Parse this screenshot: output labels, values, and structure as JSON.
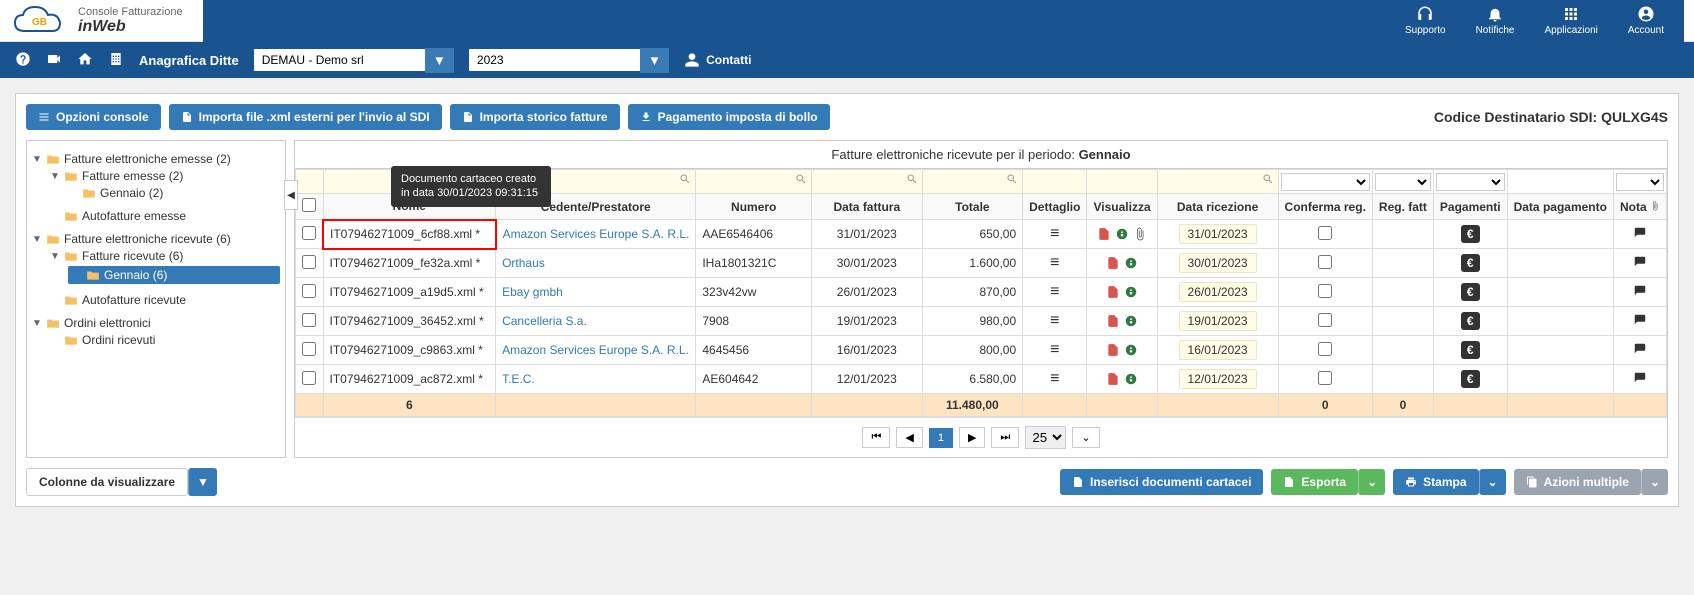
{
  "header": {
    "logo_line1": "Console Fatturazione",
    "logo_line2": "inWeb",
    "icons": [
      {
        "name": "supporto",
        "label": "Supporto"
      },
      {
        "name": "notifiche",
        "label": "Notifiche"
      },
      {
        "name": "applicazioni",
        "label": "Applicazioni"
      },
      {
        "name": "account",
        "label": "Account"
      }
    ]
  },
  "nav": {
    "anagrafica_label": "Anagrafica Ditte",
    "company_select": "DEMAU - Demo srl",
    "year_select": "2023",
    "contatti": "Contatti"
  },
  "toolbar": {
    "opzioni": "Opzioni console",
    "importa_xml": "Importa file .xml esterni per l'invio al SDI",
    "importa_storico": "Importa storico fatture",
    "pagamento_bollo": "Pagamento imposta di bollo",
    "sdi_label": "Codice Destinatario SDI: ",
    "sdi_code": "QULXG4S"
  },
  "tree": {
    "emesse": "Fatture elettroniche emesse (2)",
    "fatture_emesse": "Fatture emesse (2)",
    "gennaio_emesse": "Gennaio (2)",
    "autofatture_emesse": "Autofatture emesse",
    "ricevute": "Fatture elettroniche ricevute (6)",
    "fatture_ricevute": "Fatture ricevute (6)",
    "gennaio_ricevute": "Gennaio (6)",
    "autofatture_ricevute": "Autofatture ricevute",
    "ordini": "Ordini elettronici",
    "ordini_ricevuti": "Ordini ricevuti"
  },
  "table": {
    "title_prefix": "Fatture elettroniche ricevute per il periodo: ",
    "title_period": "Gennaio",
    "headers": {
      "nome": "Nome",
      "cedente": "Cedente/Prestatore",
      "numero": "Numero",
      "data_fattura": "Data fattura",
      "totale": "Totale",
      "dettaglio": "Dettaglio",
      "visualizza": "Visualizza",
      "data_ricezione": "Data ricezione",
      "conferma": "Conferma reg.",
      "reg_fatt": "Reg. fatt",
      "pagamenti": "Pagamenti",
      "data_pagamento": "Data pagamento",
      "nota": "Nota"
    },
    "tooltip": "Documento cartaceo creato in data 30/01/2023 09:31:15",
    "rows": [
      {
        "nome": "IT07946271009_6cf88.xml *",
        "cedente": "Amazon Services Europe S.A. R.L.",
        "numero": "AAE6546406",
        "data_fattura": "31/01/2023",
        "totale": "650,00",
        "data_ricezione": "31/01/2023",
        "has_clip": true
      },
      {
        "nome": "IT07946271009_fe32a.xml *",
        "cedente": "Orthaus",
        "numero": "IHa1801321C",
        "data_fattura": "30/01/2023",
        "totale": "1.600,00",
        "data_ricezione": "30/01/2023",
        "has_clip": false
      },
      {
        "nome": "IT07946271009_a19d5.xml *",
        "cedente": "Ebay gmbh",
        "numero": "323v42vw",
        "data_fattura": "26/01/2023",
        "totale": "870,00",
        "data_ricezione": "26/01/2023",
        "has_clip": false
      },
      {
        "nome": "IT07946271009_36452.xml *",
        "cedente": "Cancelleria S.a.",
        "numero": "7908",
        "data_fattura": "19/01/2023",
        "totale": "980,00",
        "data_ricezione": "19/01/2023",
        "has_clip": false
      },
      {
        "nome": "IT07946271009_c9863.xml *",
        "cedente": "Amazon Services Europe S.A. R.L.",
        "numero": "4645456",
        "data_fattura": "16/01/2023",
        "totale": "800,00",
        "data_ricezione": "16/01/2023",
        "has_clip": false
      },
      {
        "nome": "IT07946271009_ac872.xml *",
        "cedente": "T.E.C.",
        "numero": "AE604642",
        "data_fattura": "12/01/2023",
        "totale": "6.580,00",
        "data_ricezione": "12/01/2023",
        "has_clip": false
      }
    ],
    "totals": {
      "count": "6",
      "sum": "11.480,00",
      "conferma": "0",
      "reg": "0"
    }
  },
  "pagination": {
    "page": "1",
    "size": "25"
  },
  "bottom": {
    "colonne": "Colonne da visualizzare",
    "inserisci": "Inserisci documenti cartacei",
    "esporta": "Esporta",
    "stampa": "Stampa",
    "azioni": "Azioni multiple"
  }
}
